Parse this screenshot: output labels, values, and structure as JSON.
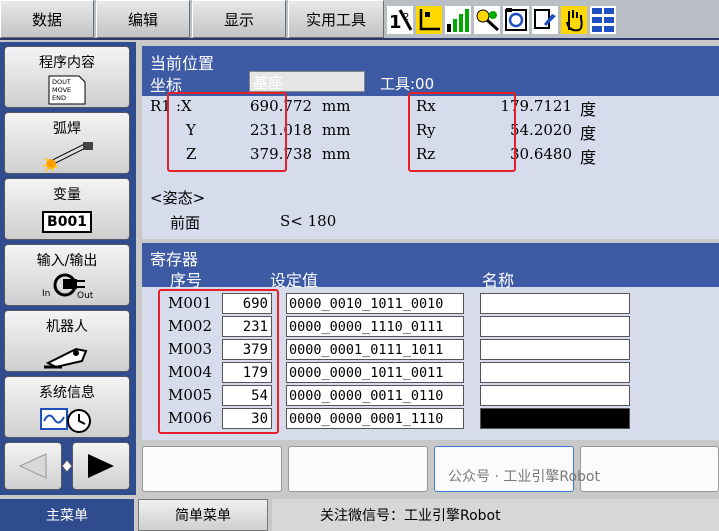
{
  "menubar": {
    "items": [
      "数据",
      "编辑",
      "显示",
      "实用工具"
    ]
  },
  "sidebar": {
    "items": [
      {
        "label": "程序内容",
        "icon_text": "DOUT\nMOVE\nEND"
      },
      {
        "label": "弧焊"
      },
      {
        "label": "变量",
        "icon_text": "B001"
      },
      {
        "label": "输入/输出",
        "icon_in": "In",
        "icon_out": "Out"
      },
      {
        "label": "机器人"
      },
      {
        "label": "系统信息"
      }
    ]
  },
  "position": {
    "title": "当前位置",
    "coord_label": "坐标",
    "coord_value": "基座",
    "tool": "工具:00",
    "robot": "R1",
    "axes": [
      {
        "name": ":X",
        "value": "690.772",
        "unit": "mm"
      },
      {
        "name": "Y",
        "value": "231.018",
        "unit": "mm"
      },
      {
        "name": "Z",
        "value": "379.738",
        "unit": "mm"
      }
    ],
    "rot": [
      {
        "name": "Rx",
        "value": "179.7121",
        "unit": "度"
      },
      {
        "name": "Ry",
        "value": "54.2020",
        "unit": "度"
      },
      {
        "name": "Rz",
        "value": "30.6480",
        "unit": "度"
      }
    ],
    "posture_title": "<姿态>",
    "posture_front": "前面",
    "posture_s": "S< 180"
  },
  "register": {
    "title": "寄存器",
    "col_no": "序号",
    "col_value": "设定值",
    "col_name": "名称",
    "rows": [
      {
        "id": "M001",
        "value": "690",
        "bin": "0000_0010_1011_0010"
      },
      {
        "id": "M002",
        "value": "231",
        "bin": "0000_0000_1110_0111"
      },
      {
        "id": "M003",
        "value": "379",
        "bin": "0000_0001_0111_1011"
      },
      {
        "id": "M004",
        "value": "179",
        "bin": "0000_0000_1011_0011"
      },
      {
        "id": "M005",
        "value": "54",
        "bin": "0000_0000_0011_0110"
      },
      {
        "id": "M006",
        "value": "30",
        "bin": "0000_0000_0001_1110"
      }
    ]
  },
  "bottom": {
    "main_menu": "主菜单",
    "simple_menu": "简单菜单",
    "status": "关注微信号：工业引擎Robot",
    "watermark": "公众号 · 工业引擎Robot"
  },
  "colors": {
    "header_blue": "#3d5aa5",
    "panel_bg": "#d7dcec",
    "side_blue": "#2f4d8e",
    "highlight_red": "#e8202a"
  }
}
